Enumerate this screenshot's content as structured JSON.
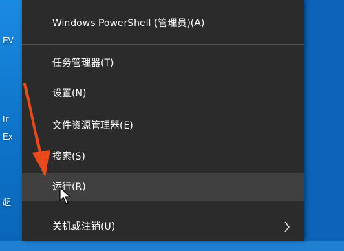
{
  "desktop": {
    "icon_labels": [
      "EV",
      "Ir",
      "Ex",
      "超"
    ]
  },
  "menu": {
    "items": [
      {
        "label": "Windows PowerShell (管理员)(A)"
      },
      {
        "label": "任务管理器(T)"
      },
      {
        "label": "设置(N)"
      },
      {
        "label": "文件资源管理器(E)"
      },
      {
        "label": "搜索(S)"
      },
      {
        "label": "运行(R)",
        "hovered": true
      },
      {
        "label": "关机或注销(U)",
        "submenu_icon": "chevron-right-icon"
      }
    ]
  },
  "colors": {
    "menu_bg": "#2b2b2b",
    "hover_bg": "#404040",
    "separator": "#555555",
    "annotation_arrow": "#e8491d",
    "desktop_bg": "#1a8ae0"
  }
}
